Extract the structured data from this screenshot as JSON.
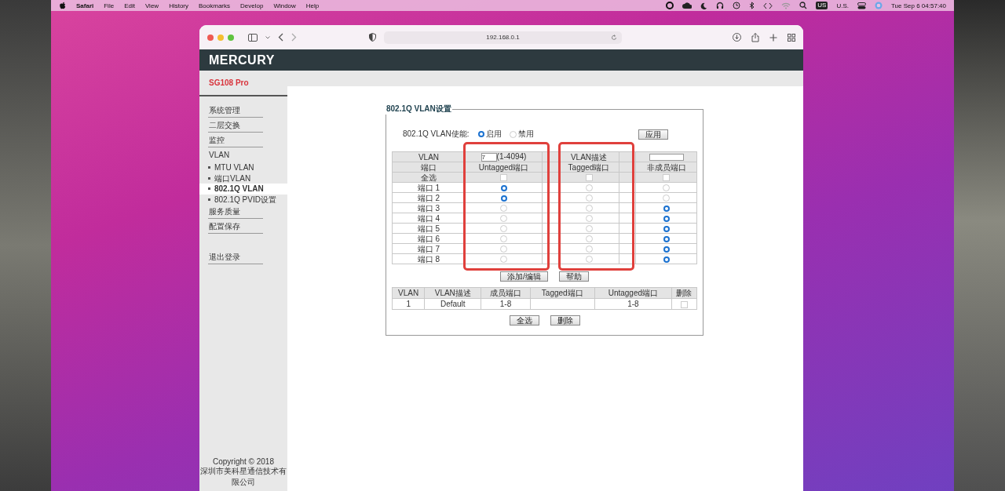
{
  "menubar": {
    "app": "Safari",
    "menus": [
      "File",
      "Edit",
      "View",
      "History",
      "Bookmarks",
      "Develop",
      "Window",
      "Help"
    ],
    "input_source": "US",
    "input_label": "U.S.",
    "clock": "Tue Sep 6 04:57:40"
  },
  "browser": {
    "url": "192.168.0.1"
  },
  "header": {
    "logo": "MERCURY",
    "model": "SG108 Pro"
  },
  "sidebar": {
    "items": [
      {
        "label": "系统管理",
        "selected": false
      },
      {
        "label": "二层交换",
        "selected": false
      },
      {
        "label": "监控",
        "selected": false
      },
      {
        "label": "VLAN",
        "selected": false,
        "children": [
          {
            "label": "MTU VLAN",
            "selected": false
          },
          {
            "label": "端口VLAN",
            "selected": false
          },
          {
            "label": "802.1Q VLAN",
            "selected": true
          },
          {
            "label": "802.1Q PVID设置",
            "selected": false
          }
        ]
      },
      {
        "label": "服务质量",
        "selected": false
      },
      {
        "label": "配置保存",
        "selected": false
      }
    ],
    "logout": {
      "label": "退出登录",
      "selected": false
    }
  },
  "panel": {
    "title": "802.1Q VLAN设置",
    "enable": {
      "label": "802.1Q VLAN使能:",
      "options": [
        {
          "label": "启用",
          "selected": true
        },
        {
          "label": "禁用",
          "selected": false
        }
      ],
      "apply_button": "应用"
    },
    "vlan_table": {
      "vlan_label": "VLAN",
      "vlan_id": "7",
      "vlan_range": "(1-4094)",
      "description_label": "VLAN描述",
      "port_label": "端口",
      "columns": [
        "Untagged端口",
        "Tagged端口",
        "非成员端口"
      ],
      "select_all": {
        "label": "全选",
        "boxes": [
          {
            "checked": false
          },
          {
            "checked": false
          },
          {
            "checked": false
          }
        ]
      },
      "ports": [
        {
          "label": "端口 1",
          "choices": [
            {
              "selected": true
            },
            {
              "selected": false
            },
            {
              "selected": false
            }
          ]
        },
        {
          "label": "端口 2",
          "choices": [
            {
              "selected": true
            },
            {
              "selected": false
            },
            {
              "selected": false
            }
          ]
        },
        {
          "label": "端口 3",
          "choices": [
            {
              "selected": false
            },
            {
              "selected": false
            },
            {
              "selected": true
            }
          ]
        },
        {
          "label": "端口 4",
          "choices": [
            {
              "selected": false
            },
            {
              "selected": false
            },
            {
              "selected": true
            }
          ]
        },
        {
          "label": "端口 5",
          "choices": [
            {
              "selected": false
            },
            {
              "selected": false
            },
            {
              "selected": true
            }
          ]
        },
        {
          "label": "端口 6",
          "choices": [
            {
              "selected": false
            },
            {
              "selected": false
            },
            {
              "selected": true
            }
          ]
        },
        {
          "label": "端口 7",
          "choices": [
            {
              "selected": false
            },
            {
              "selected": false
            },
            {
              "selected": true
            }
          ]
        },
        {
          "label": "端口 8",
          "choices": [
            {
              "selected": false
            },
            {
              "selected": false
            },
            {
              "selected": true
            }
          ]
        }
      ]
    },
    "buttons": [
      "添加/编辑",
      "帮助"
    ],
    "list_table": {
      "columns": [
        "VLAN",
        "VLAN描述",
        "成员端口",
        "Tagged端口",
        "Untagged端口",
        "删除"
      ],
      "rows": [
        {
          "vlan": "1",
          "description": "Default",
          "members": "1-8",
          "untagged": "1-8",
          "delete_checked": false
        }
      ]
    },
    "bottom_buttons": [
      "全选",
      "删除"
    ]
  },
  "footer": {
    "copyright": "Copyright © 2018",
    "company": "深圳市美科星通信技术有限公司"
  }
}
